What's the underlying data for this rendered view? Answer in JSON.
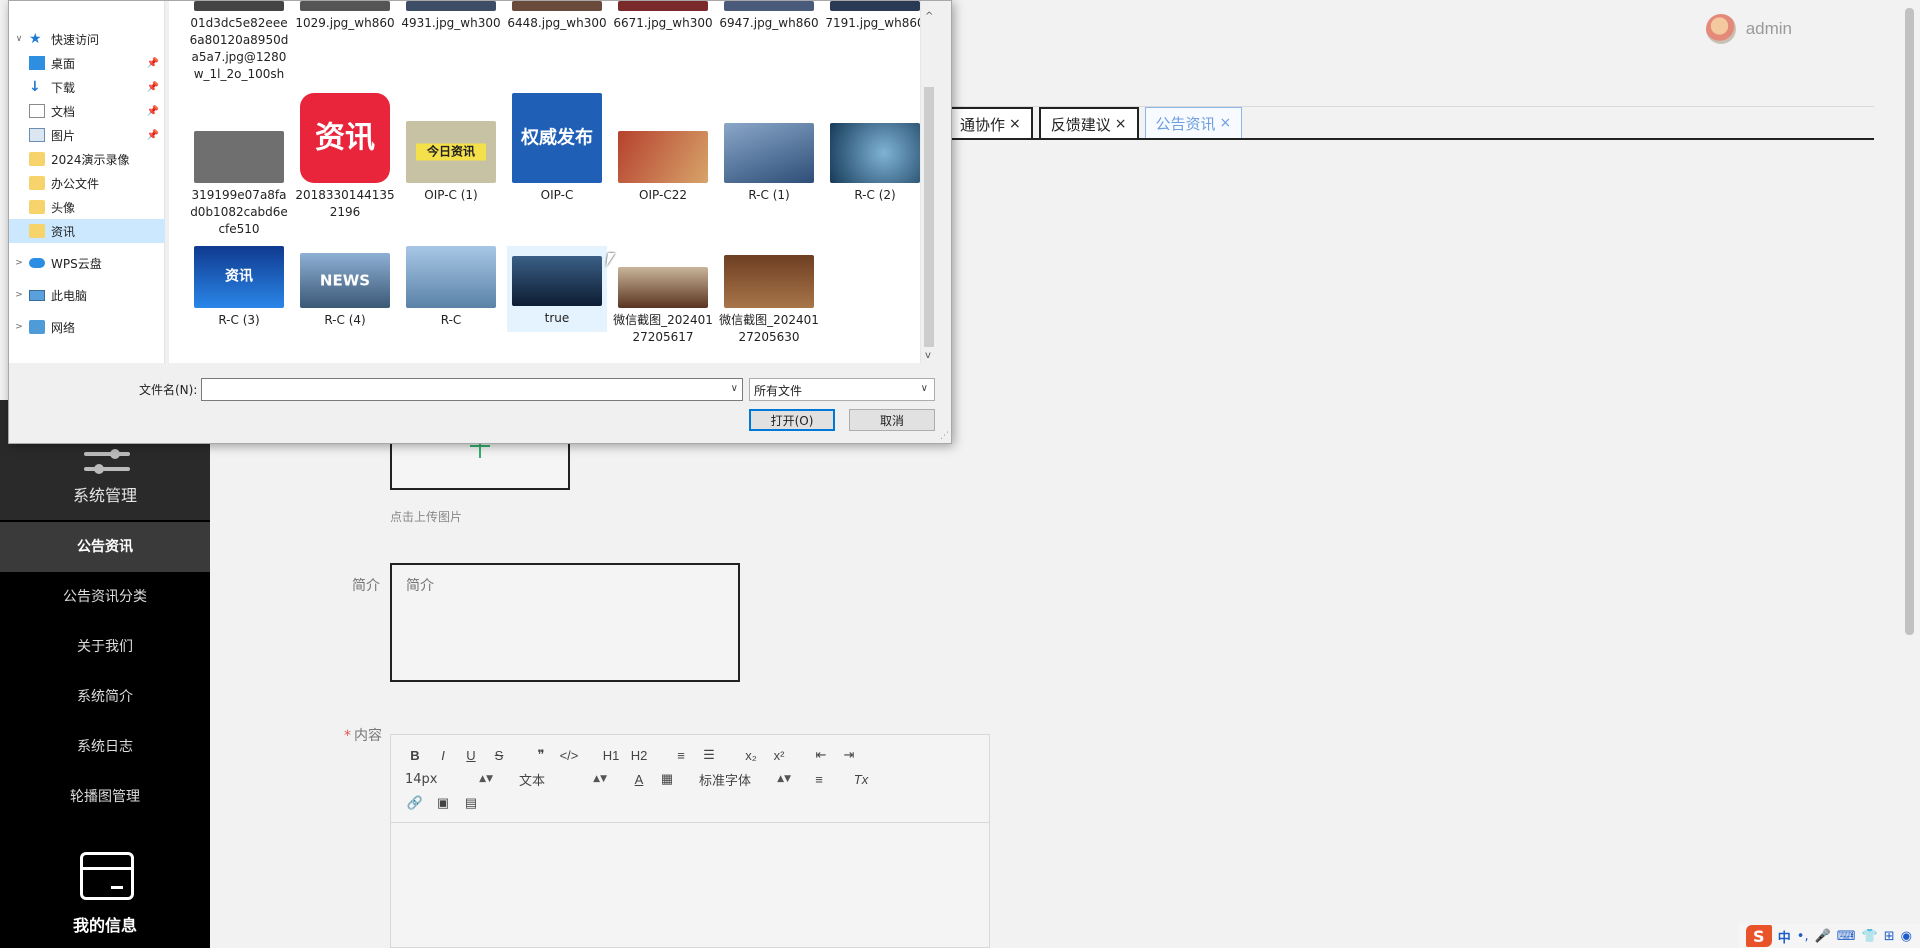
{
  "header": {
    "user": "admin"
  },
  "tabs": [
    {
      "label": "通协作",
      "close": "×"
    },
    {
      "label": "反馈建议",
      "close": "×"
    },
    {
      "label": "公告资讯",
      "close": "×",
      "active": true
    }
  ],
  "sidebar": {
    "section_title": "系统管理",
    "items": [
      {
        "label": "公告资讯",
        "active": true
      },
      {
        "label": "公告资讯分类"
      },
      {
        "label": "关于我们"
      },
      {
        "label": "系统简介"
      },
      {
        "label": "系统日志"
      },
      {
        "label": "轮播图管理"
      }
    ],
    "bottom_label": "我的信息"
  },
  "form": {
    "upload_hint": "点击上传图片",
    "intro_label": "简介",
    "intro_placeholder": "简介",
    "content_required": "*",
    "content_label": "内容",
    "editor": {
      "row1": [
        "B",
        "I",
        "U",
        "S",
        "❞",
        "</>",
        "H1",
        "H2",
        "≡",
        "☰",
        "x₂",
        "x²",
        "⇤",
        "⇥"
      ],
      "font_size": "14px",
      "text_style": "文本",
      "font_family": "标准字体",
      "row2_icons": [
        "A",
        "▦",
        "≡",
        "Tx"
      ],
      "row3_icons": [
        "🔗",
        "▣",
        "▤"
      ]
    }
  },
  "dialog": {
    "nav": [
      {
        "label": "快速访问",
        "icon": "star-icon",
        "chev": "∨"
      },
      {
        "label": "桌面",
        "icon": "desktop-icon",
        "pin": true
      },
      {
        "label": "下载",
        "icon": "download-icon",
        "pin": true
      },
      {
        "label": "文档",
        "icon": "document-icon",
        "pin": true
      },
      {
        "label": "图片",
        "icon": "picture-icon",
        "pin": true
      },
      {
        "label": "2024演示录像",
        "icon": "folder-icon"
      },
      {
        "label": "办公文件",
        "icon": "folder-icon"
      },
      {
        "label": "头像",
        "icon": "folder-icon"
      },
      {
        "label": "资讯",
        "icon": "folder-icon",
        "selected": true
      },
      {
        "label": "WPS云盘",
        "icon": "cloud-icon",
        "chev": ">"
      },
      {
        "label": "此电脑",
        "icon": "computer-icon",
        "chev": ">"
      },
      {
        "label": "网络",
        "icon": "network-icon",
        "chev": ">"
      }
    ],
    "files_row1": [
      "01d3dc5e82eee6a80120a8950da5a7.jpg@1280w_1l_2o_100sh",
      "1029.jpg_wh860",
      "4931.jpg_wh300",
      "6448.jpg_wh300",
      "6671.jpg_wh300",
      "6947.jpg_wh860",
      "7191.jpg_wh860"
    ],
    "files_row2": [
      {
        "name": "319199e07a8fad0b1082cabd6ecfe510",
        "color": "#6f6f6f",
        "text": ""
      },
      {
        "name": "20183301441352196",
        "color": "#e8253a",
        "text": "资讯"
      },
      {
        "name": "OIP-C (1)",
        "color": "#c8c2a4",
        "text": "今日资讯"
      },
      {
        "name": "OIP-C",
        "color": "#1f5fb6",
        "text": "权威发布"
      },
      {
        "name": "OIP-C22",
        "color": "#b6412e",
        "text": ""
      },
      {
        "name": "R-C (1)",
        "color": "#4b6c93",
        "text": ""
      },
      {
        "name": "R-C (2)",
        "color": "#2e5672",
        "text": ""
      }
    ],
    "files_row3": [
      {
        "name": "R-C (3)",
        "color": "#1d5bbf",
        "text": "资讯"
      },
      {
        "name": "R-C (4)",
        "color": "#5b7ea5",
        "text": "NEWS"
      },
      {
        "name": "R-C",
        "color": "#6c9bc9",
        "text": ""
      },
      {
        "name": "true",
        "color": "#1c3556",
        "text": ""
      },
      {
        "name": "微信截图_20240127205617",
        "color": "#7a4a2c",
        "text": ""
      },
      {
        "name": "微信截图_20240127205630",
        "color": "#8a5a35",
        "text": ""
      }
    ],
    "filename_label": "文件名(N):",
    "filename_value": "",
    "filetype": "所有文件",
    "open_button": "打开(O)",
    "cancel_button": "取消"
  },
  "ime": {
    "logo": "S",
    "mode": "中",
    "punct": "•,",
    "mic": "🎤",
    "keyboard": "⌨",
    "skin": "👕",
    "grid": "⊞",
    "extra": "◉"
  }
}
